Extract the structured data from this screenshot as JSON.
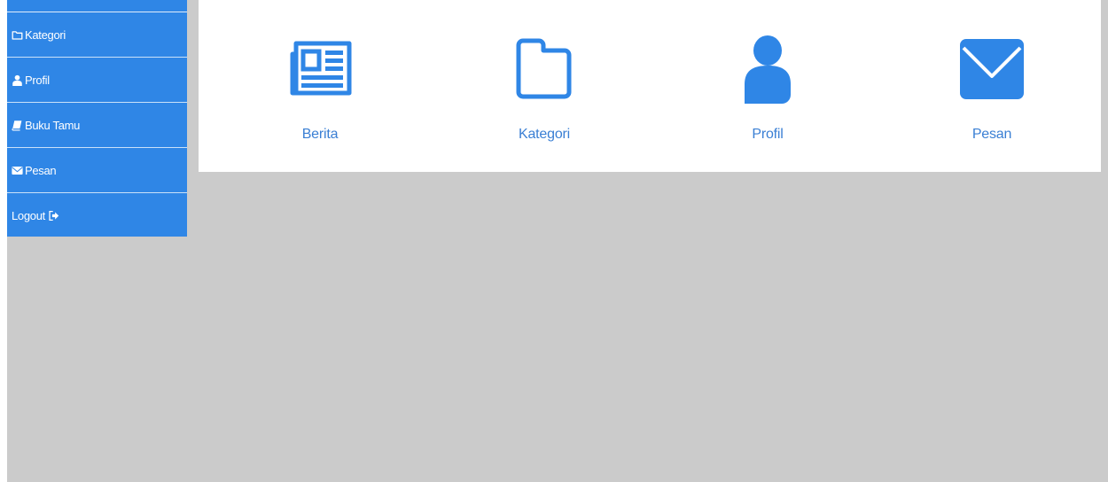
{
  "sidebar": {
    "items": [
      {
        "label": "Kategori",
        "icon": "folder-icon"
      },
      {
        "label": "Profil",
        "icon": "user-icon"
      },
      {
        "label": "Buku Tamu",
        "icon": "book-icon"
      },
      {
        "label": "Pesan",
        "icon": "envelope-icon"
      },
      {
        "label": "Logout",
        "icon": "logout-icon"
      }
    ]
  },
  "dashboard": {
    "tiles": [
      {
        "label": "Berita",
        "icon": "newspaper-icon"
      },
      {
        "label": "Kategori",
        "icon": "folder-icon"
      },
      {
        "label": "Profil",
        "icon": "user-icon"
      },
      {
        "label": "Pesan",
        "icon": "envelope-icon"
      }
    ]
  },
  "colors": {
    "accent": "#2f86e6",
    "page_background": "#cbcbcb",
    "panel_background": "#ffffff",
    "tile_label": "#3a7fd4"
  }
}
